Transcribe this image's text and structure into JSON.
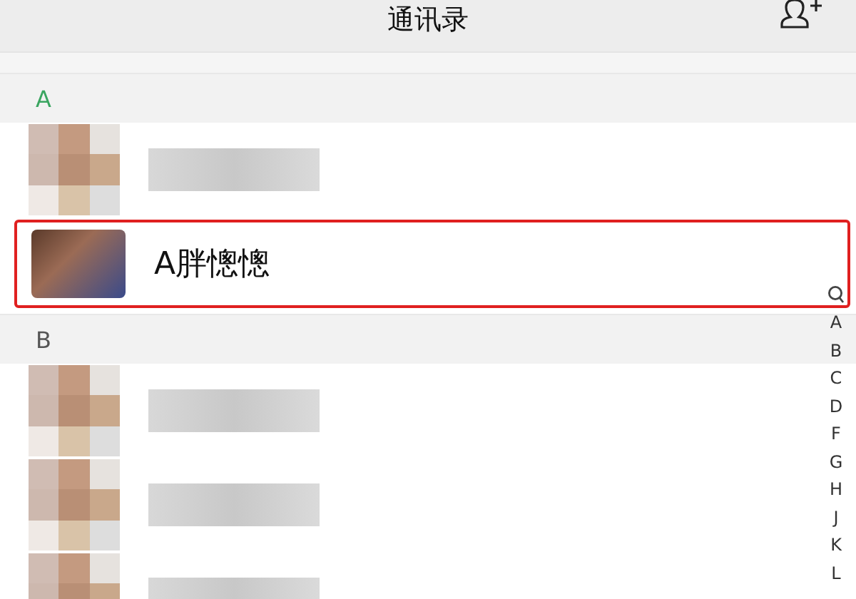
{
  "header": {
    "title": "通讯录"
  },
  "sections": [
    {
      "letter": "A",
      "active": true,
      "rows": [
        {
          "kind": "blurred"
        },
        {
          "kind": "contact",
          "name": "A胖憁憁",
          "highlighted": true
        }
      ]
    },
    {
      "letter": "B",
      "active": false,
      "rows": [
        {
          "kind": "blurred"
        },
        {
          "kind": "blurred"
        },
        {
          "kind": "blurred"
        }
      ]
    }
  ],
  "index": [
    "A",
    "B",
    "C",
    "D",
    "F",
    "G",
    "H",
    "J",
    "K",
    "L"
  ]
}
